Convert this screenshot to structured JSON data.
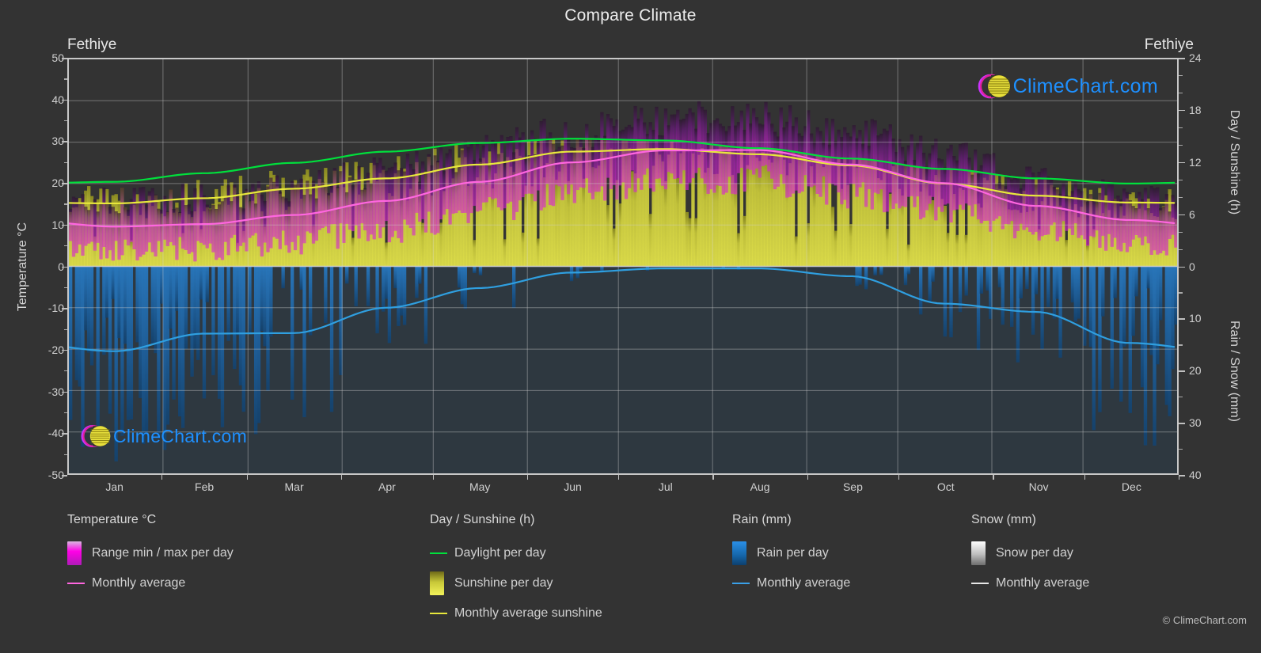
{
  "header": {
    "title": "Compare Climate",
    "station_left": "Fethiye",
    "station_right": "Fethiye"
  },
  "axes": {
    "y_left_title": "Temperature °C",
    "y_right_top_title": "Day / Sunshine (h)",
    "y_right_bottom_title": "Rain / Snow (mm)",
    "y_left_ticks": [
      "50",
      "40",
      "30",
      "20",
      "10",
      "0",
      "-10",
      "-20",
      "-30",
      "-40",
      "-50"
    ],
    "y_right_top_ticks": [
      "24",
      "18",
      "12",
      "6",
      "0"
    ],
    "y_right_bottom_ticks": [
      "0",
      "10",
      "20",
      "30",
      "40"
    ],
    "x_ticks": [
      "Jan",
      "Feb",
      "Mar",
      "Apr",
      "May",
      "Jun",
      "Jul",
      "Aug",
      "Sep",
      "Oct",
      "Nov",
      "Dec"
    ]
  },
  "legend": {
    "columns": [
      {
        "title": "Temperature °C",
        "items": [
          {
            "label": "Range min / max per day",
            "kind": "swatch",
            "color": "#ff00dd"
          },
          {
            "label": "Monthly average",
            "kind": "line",
            "color": "#ff66e0"
          }
        ]
      },
      {
        "title": "Day / Sunshine (h)",
        "items": [
          {
            "label": "Daylight per day",
            "kind": "line",
            "color": "#00e03c"
          },
          {
            "label": "Sunshine per day",
            "kind": "swatch",
            "color": "#eaea3c"
          },
          {
            "label": "Monthly average sunshine",
            "kind": "line",
            "color": "#e8e83c"
          }
        ]
      },
      {
        "title": "Rain (mm)",
        "items": [
          {
            "label": "Rain per day",
            "kind": "swatch",
            "color": "#1e90e8"
          },
          {
            "label": "Monthly average",
            "kind": "line",
            "color": "#3aa0e8"
          }
        ]
      },
      {
        "title": "Snow (mm)",
        "items": [
          {
            "label": "Snow per day",
            "kind": "swatch",
            "color": "#e8e8e8"
          },
          {
            "label": "Monthly average",
            "kind": "line",
            "color": "#e8e8e8"
          }
        ]
      }
    ]
  },
  "watermark": {
    "text": "ClimeChart.com",
    "copyright": "© ClimeChart.com"
  },
  "chart_data": {
    "type": "area",
    "title": "Compare Climate",
    "subtitle": "Fethiye",
    "xlabel": "",
    "ylabel": "Temperature °C",
    "ylim": [
      -50,
      50
    ],
    "y_right_top_lim": [
      0,
      24
    ],
    "y_right_bottom_lim": [
      0,
      40
    ],
    "grid": true,
    "legend_position": "bottom",
    "categories": [
      "Jan",
      "Feb",
      "Mar",
      "Apr",
      "May",
      "Jun",
      "Jul",
      "Aug",
      "Sep",
      "Oct",
      "Nov",
      "Dec"
    ],
    "series": [
      {
        "name": "Monthly average temperature",
        "unit": "°C",
        "color": "#ff66e0",
        "values": [
          9.6,
          10.2,
          12.4,
          15.8,
          20.4,
          25.1,
          28.0,
          28.1,
          24.6,
          20.1,
          14.6,
          11.2
        ]
      },
      {
        "name": "Daily max temperature (range top)",
        "unit": "°C",
        "color": "#cc22cc",
        "values": [
          15.3,
          16.1,
          18.6,
          22.3,
          27.1,
          32.0,
          35.2,
          35.3,
          31.4,
          26.4,
          20.6,
          16.5
        ]
      },
      {
        "name": "Daily min temperature (range bottom)",
        "unit": "°C",
        "color": "#cc22cc",
        "values": [
          4.2,
          4.5,
          6.2,
          9.2,
          13.5,
          18.0,
          21.1,
          21.3,
          17.8,
          13.9,
          9.1,
          5.9
        ]
      },
      {
        "name": "Daylight per day",
        "unit": "h",
        "color": "#00e03c",
        "values": [
          9.8,
          10.8,
          12.0,
          13.3,
          14.3,
          14.8,
          14.6,
          13.7,
          12.5,
          11.3,
          10.2,
          9.6
        ]
      },
      {
        "name": "Monthly average sunshine",
        "unit": "h",
        "color": "#e8e83c",
        "values": [
          7.3,
          7.9,
          9.0,
          10.2,
          11.8,
          13.3,
          13.6,
          13.0,
          11.7,
          9.6,
          8.2,
          7.4
        ]
      },
      {
        "name": "Rain monthly average",
        "unit": "mm",
        "color": "#3aa0e8",
        "values": [
          16.4,
          13.0,
          12.9,
          8.0,
          4.2,
          1.2,
          0.4,
          0.4,
          1.9,
          7.2,
          8.8,
          14.8
        ]
      },
      {
        "name": "Snow monthly average",
        "unit": "mm",
        "color": "#e8e8e8",
        "values": [
          0,
          0,
          0,
          0,
          0,
          0,
          0,
          0,
          0,
          0,
          0,
          0
        ]
      }
    ]
  }
}
